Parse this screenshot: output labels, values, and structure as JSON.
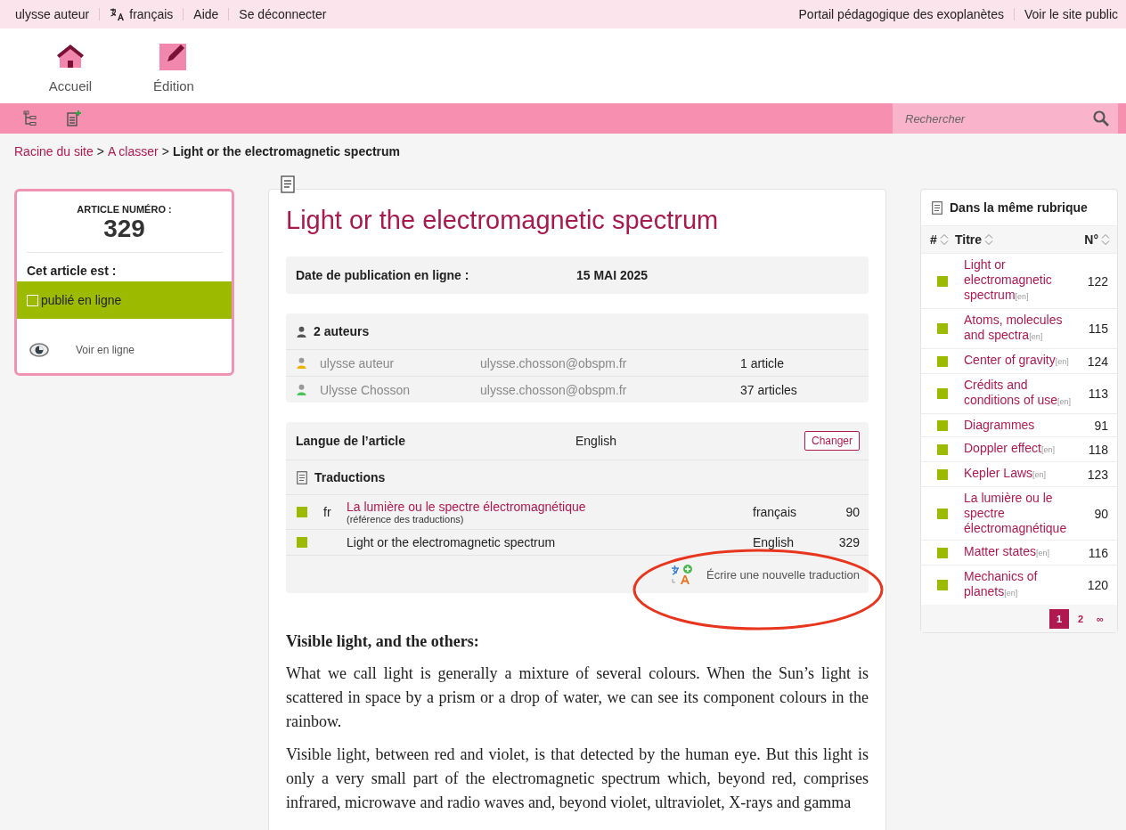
{
  "top_bar": {
    "left": [
      {
        "kind": "text",
        "label": "ulysse auteur"
      },
      {
        "kind": "lang",
        "label": "français"
      },
      {
        "kind": "text",
        "label": "Aide"
      },
      {
        "kind": "text",
        "label": "Se déconnecter"
      }
    ],
    "right": [
      "Portail pédagogique des exoplanètes",
      "Voir le site public"
    ]
  },
  "header_nav": [
    {
      "kind": "home",
      "label": "Accueil"
    },
    {
      "kind": "edit",
      "label": "Édition"
    }
  ],
  "search": {
    "placeholder": "Rechercher"
  },
  "breadcrumb": [
    {
      "kind": "link",
      "text": "Racine du site"
    },
    {
      "kind": "sep",
      "text": ">"
    },
    {
      "kind": "link",
      "text": "A classer"
    },
    {
      "kind": "sep",
      "text": ">"
    },
    {
      "kind": "current",
      "text": "Light or the electromagnetic spectrum"
    }
  ],
  "article_box": {
    "label": "ARTICLE NUMÉRO :",
    "number": "329",
    "status_heading": "Cet article est :",
    "status": {
      "label": "publié en ligne",
      "checked": false
    },
    "view_link": "Voir en ligne"
  },
  "article": {
    "title": "Light or the electromagnetic spectrum",
    "publication": {
      "label": "Date de publication en ligne :",
      "value": "15 MAI 2025"
    },
    "authors": {
      "heading": "2 auteurs",
      "rows": [
        {
          "name": "ulysse auteur",
          "email": "ulysse.chosson@obspm.fr",
          "count": "1 article",
          "color": "#f0b400"
        },
        {
          "name": "Ulysse Chosson",
          "email": "ulysse.chosson@obspm.fr",
          "count": "37 articles",
          "color": "#4cc35a"
        }
      ]
    },
    "language": {
      "label": "Langue de l’article",
      "value": "English",
      "button": "Changer"
    },
    "translations": {
      "heading": "Traductions",
      "rows": [
        {
          "code": "fr",
          "title": "La lumière ou le spectre électromagnétique",
          "note": "(référence des traductions)",
          "language": "français",
          "number": "90",
          "current": false
        },
        {
          "title": "Light or the electromagnetic spectrum",
          "language": "English",
          "number": "329",
          "current": true
        }
      ],
      "new_link": "Écrire une nouvelle traduction"
    },
    "annotation": {
      "kind": "ellipse",
      "color": "#e8361e"
    },
    "body": [
      {
        "kind": "heading",
        "text": "Visible light, and the others:"
      },
      {
        "kind": "paragraph",
        "text": "What we call light is generally a mixture of several colours. When the Sun’s light is scattered in space by a prism or a drop of water, we can see its component colours in the rainbow."
      },
      {
        "kind": "paragraph",
        "text": "Visible light, between red and violet, is that detected by the human eye. But this light is only a very small part of the electromagnetic spectrum which, beyond red, comprises infrared, microwave and radio waves and, beyond violet, ultraviolet, X-rays and gamma"
      }
    ]
  },
  "same_section": {
    "heading": "Dans la même rubrique",
    "columns": [
      "#",
      "Titre",
      "N°"
    ],
    "rows": [
      {
        "title": "Light or electromagnetic spectrum",
        "tag": "[en]",
        "number": "122",
        "color": "#9cbb00"
      },
      {
        "title": "Atoms, molecules and spectra",
        "tag": "[en]",
        "number": "115",
        "color": "#9cbb00"
      },
      {
        "title": "Center of gravity",
        "tag": "[en]",
        "number": "124",
        "color": "#9cbb00"
      },
      {
        "title": "Crédits and conditions of use",
        "tag": "[en]",
        "number": "113",
        "color": "#9cbb00"
      },
      {
        "title": "Diagrammes",
        "number": "91",
        "color": "#9cbb00"
      },
      {
        "title": "Doppler effect",
        "tag": "[en]",
        "number": "118",
        "color": "#9cbb00"
      },
      {
        "title": "Kepler Laws",
        "tag": "[en]",
        "number": "123",
        "color": "#9cbb00"
      },
      {
        "title": "La lumière ou le spectre électromagnétique",
        "number": "90",
        "color": "#9cbb00"
      },
      {
        "title": "Matter states",
        "tag": "[en]",
        "number": "116",
        "color": "#9cbb00"
      },
      {
        "title": "Mechanics of planets",
        "tag": "[en]",
        "number": "120",
        "color": "#9cbb00"
      }
    ],
    "pages": [
      {
        "label": "1",
        "selected": true
      },
      {
        "label": "2",
        "selected": false
      },
      {
        "label": "∞",
        "selected": false
      }
    ]
  }
}
